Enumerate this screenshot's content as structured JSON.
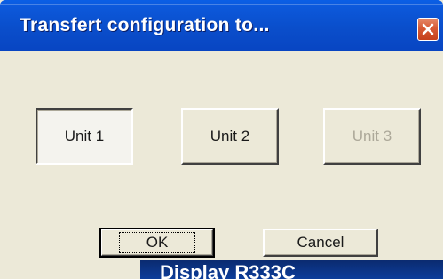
{
  "dialog": {
    "title": "Transfert configuration to...",
    "close_icon": "close-icon"
  },
  "units": [
    {
      "label": "Unit 1",
      "state": "pressed"
    },
    {
      "label": "Unit 2",
      "state": "normal"
    },
    {
      "label": "Unit 3",
      "state": "disabled"
    }
  ],
  "buttons": {
    "ok_label": "OK",
    "cancel_label": "Cancel"
  },
  "background_window": {
    "title_fragment": "Display R333C"
  },
  "colors": {
    "titlebar": "#0a4ecb",
    "close_button": "#d75a35",
    "dialog_bg": "#ece9d8",
    "disabled_text": "#aca899"
  }
}
